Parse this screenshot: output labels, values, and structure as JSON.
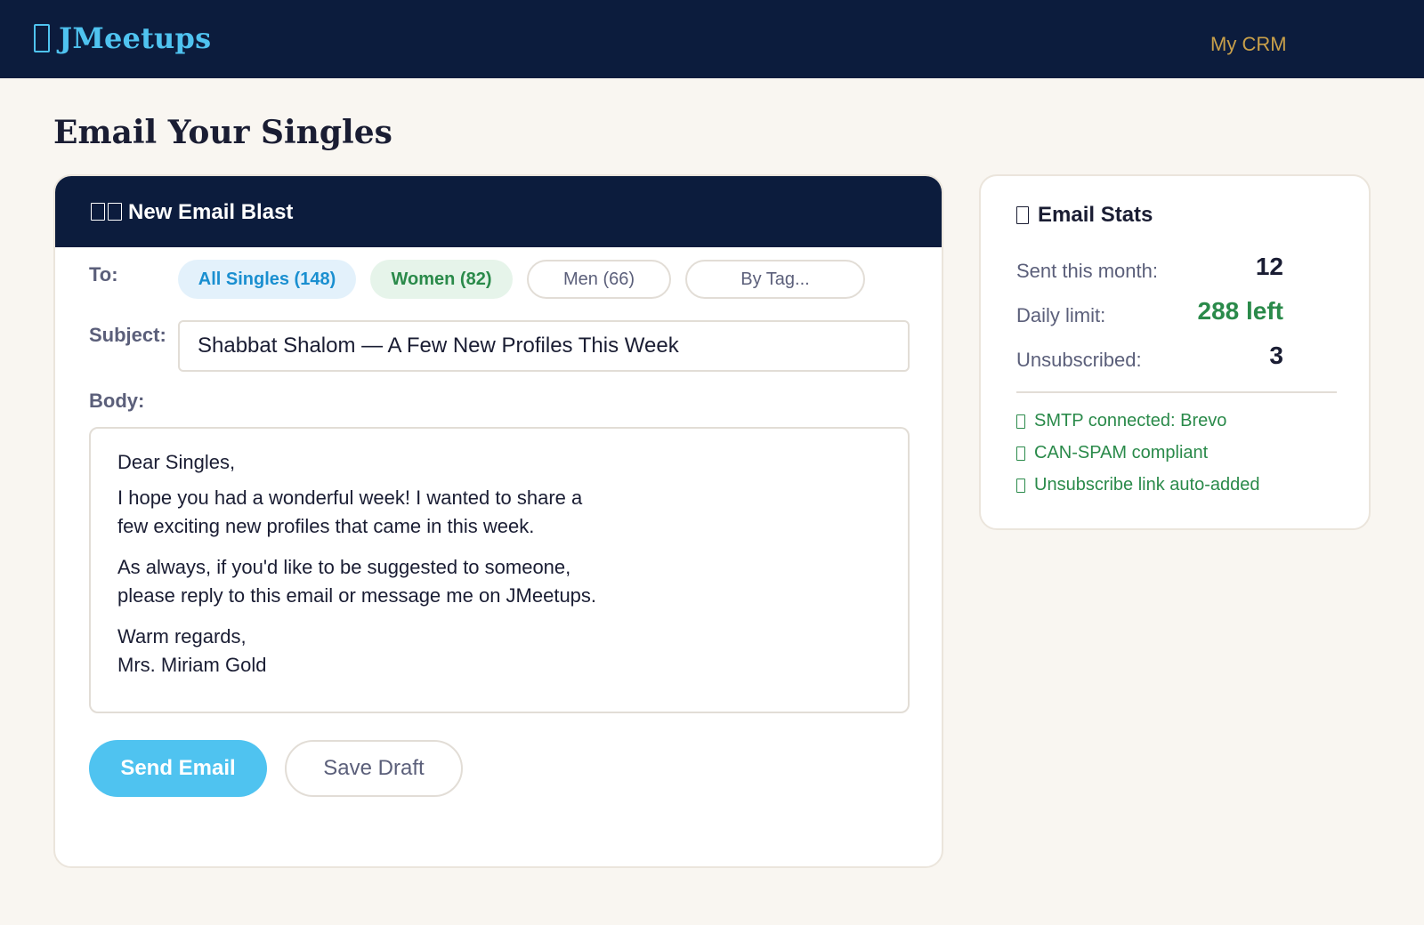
{
  "app": {
    "brand_name": "JMeetups",
    "nav_link": "My CRM"
  },
  "page": {
    "title": "Email Your Singles"
  },
  "compose": {
    "header_title": "New Email Blast",
    "to_label": "To:",
    "recipients": [
      {
        "label": "All Singles (148)",
        "selected": true
      },
      {
        "label": "Women (82)",
        "selected": false
      },
      {
        "label": "Men (66)",
        "selected": false
      },
      {
        "label": "By Tag...",
        "selected": false
      }
    ],
    "subject_label": "Subject:",
    "subject_value": "Shabbat Shalom — A Few New Profiles This Week",
    "body_label": "Body:",
    "body": {
      "greeting": "Dear Singles,",
      "para1_line1": "I hope you had a wonderful week! I wanted to share a",
      "para1_line2": "few exciting new profiles that came in this week.",
      "para2_line1": "As always, if you'd like to be suggested to someone,",
      "para2_line2": "please reply to this email or message me on JMeetups.",
      "closing": "Warm regards,",
      "signature": "Mrs. Miriam Gold"
    },
    "send_label": "Send Email",
    "draft_label": "Save Draft"
  },
  "stats": {
    "title": "Email Stats",
    "rows": [
      {
        "label": "Sent this month:",
        "value": "12"
      },
      {
        "label": "Daily limit:",
        "value": "288 left"
      },
      {
        "label": "Unsubscribed:",
        "value": "3"
      }
    ],
    "checks": [
      "SMTP connected: Brevo",
      "CAN-SPAM compliant",
      "Unsubscribe link auto-added"
    ]
  },
  "colors": {
    "navy": "#0c1c3d",
    "accent_blue": "#4fc3f0",
    "gold": "#c9a04a",
    "green": "#2a8a4a",
    "background": "#f9f6f1"
  },
  "icons": {
    "brand": "book-icon",
    "compose_header": "envelope-icon",
    "stats": "chart-icon",
    "check": "check-icon"
  }
}
